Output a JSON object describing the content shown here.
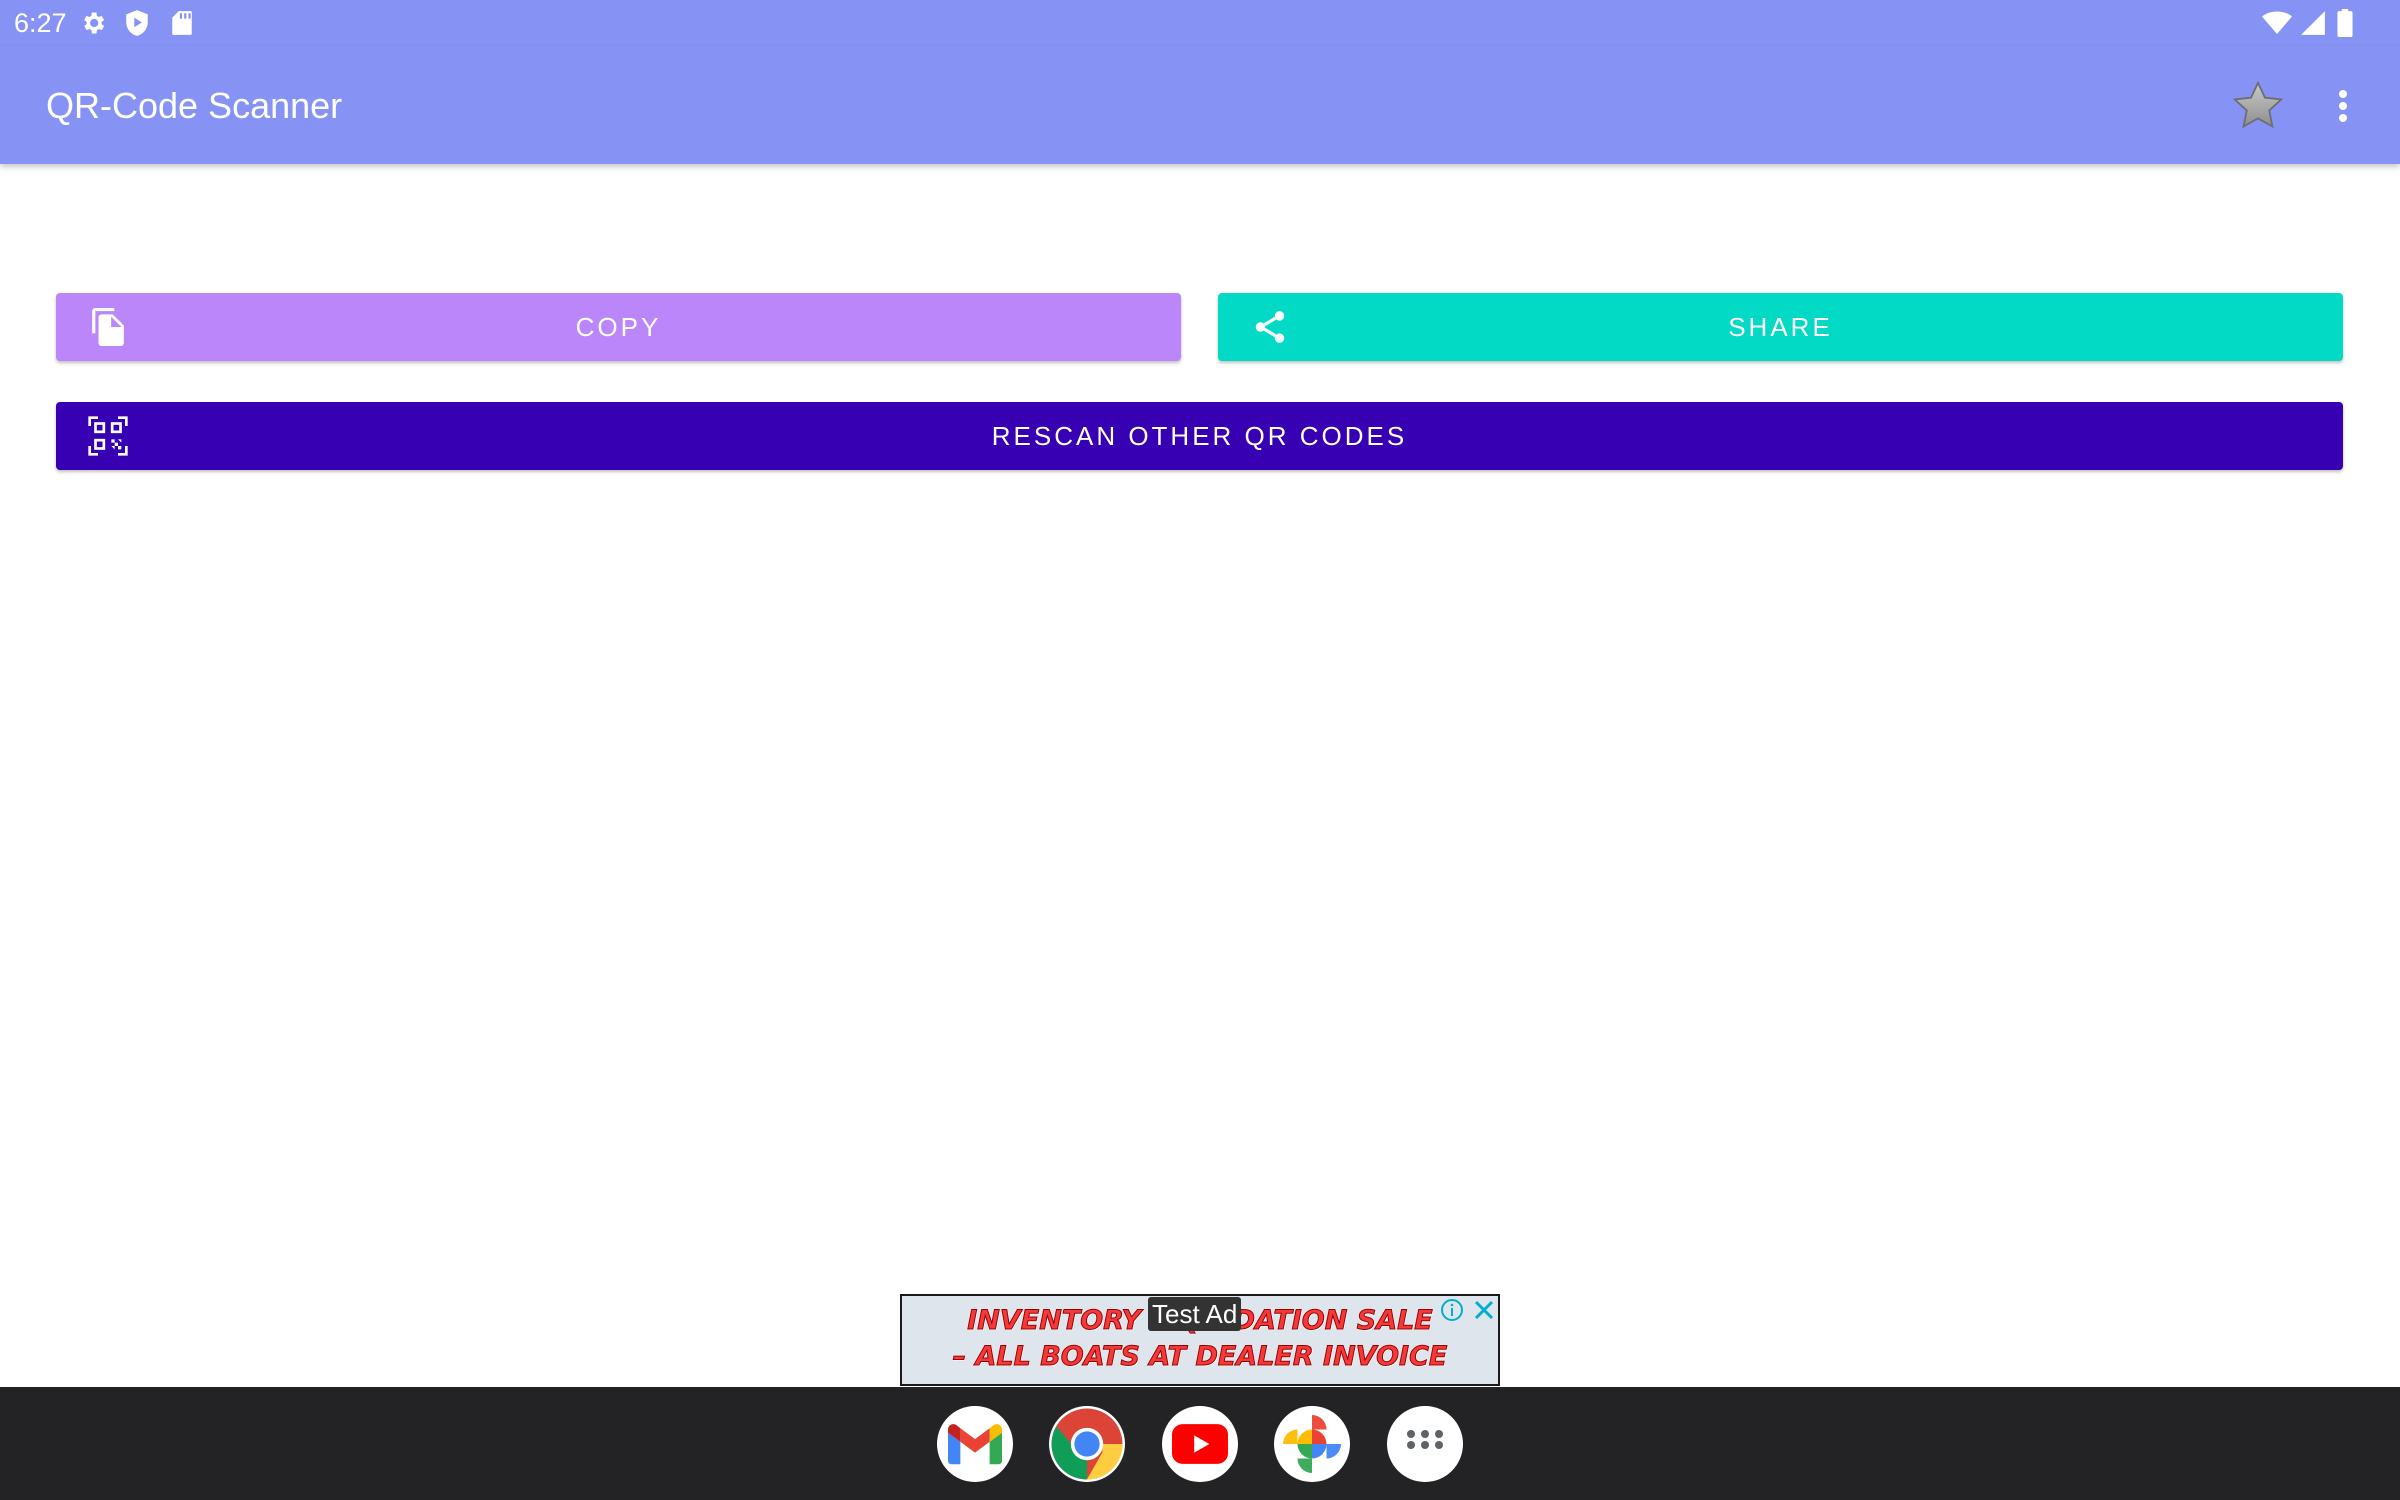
{
  "status_bar": {
    "time": "6:27",
    "left_icons": [
      "settings-icon",
      "shield-play-icon",
      "sd-card-icon"
    ],
    "right_icons": [
      "wifi-icon",
      "cell-signal-icon",
      "battery-icon"
    ]
  },
  "app_bar": {
    "title": "QR-Code Scanner",
    "actions": [
      "star-icon",
      "more-vert-icon"
    ]
  },
  "actions": {
    "copy_label": "COPY",
    "share_label": "SHARE",
    "rescan_label": "RESCAN OTHER QR CODES"
  },
  "ad": {
    "label": "Test Ad",
    "line1": "INVENTORY LIQUIDATION SALE",
    "line2": "– ALL BOATS AT DEALER INVOICE"
  },
  "dock": {
    "apps": [
      "Gmail",
      "Chrome",
      "YouTube",
      "Photos",
      "App drawer"
    ]
  },
  "colors": {
    "app_bar": "#8693f5",
    "copy_button": "#bb86fa",
    "share_button": "#03dac5",
    "rescan_button": "#3700b3",
    "dock": "#232326"
  }
}
